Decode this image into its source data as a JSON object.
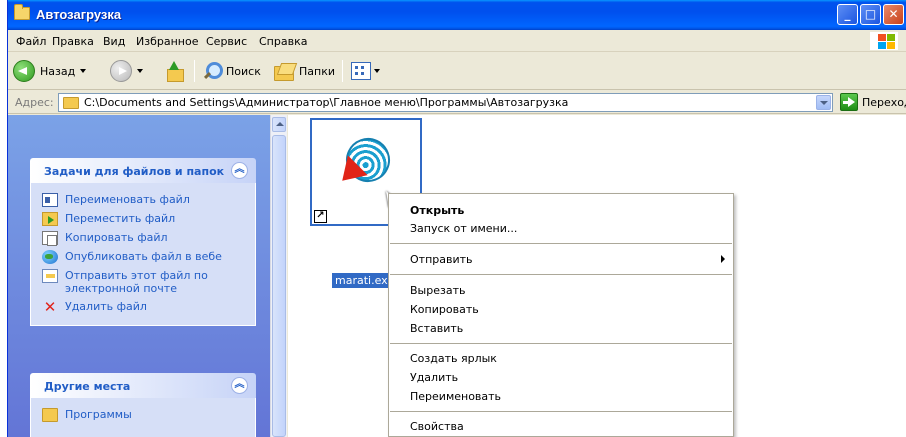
{
  "window": {
    "title": "Автозагрузка"
  },
  "menubar": {
    "items": [
      "Файл",
      "Правка",
      "Вид",
      "Избранное",
      "Сервис",
      "Справка"
    ]
  },
  "toolbar": {
    "back_label": "Назад",
    "search_label": "Поиск",
    "folders_label": "Папки"
  },
  "address": {
    "label": "Адрес:",
    "path": "C:\\Documents and Settings\\Администратор\\Главное меню\\Программы\\Автозагрузка",
    "go_label": "Переход"
  },
  "tasks_panel": {
    "title": "Задачи для файлов и папок",
    "items": [
      {
        "label": "Переименовать файл",
        "icon": "rename-icon"
      },
      {
        "label": "Переместить файл",
        "icon": "move-icon"
      },
      {
        "label": "Копировать файл",
        "icon": "copy-icon"
      },
      {
        "label": "Опубликовать файл в вебе",
        "icon": "web-publish-icon"
      },
      {
        "label": "Отправить этот файл по электронной почте",
        "icon": "mail-icon"
      },
      {
        "label": "Удалить файл",
        "icon": "delete-icon"
      }
    ]
  },
  "other_places_panel": {
    "title": "Другие места",
    "items": [
      {
        "label": "Программы",
        "icon": "folder-icon"
      }
    ]
  },
  "file": {
    "name": "marati.exe",
    "name_visible": "marati.ex"
  },
  "context_menu": {
    "items": [
      {
        "label": "Открыть",
        "bold": true
      },
      {
        "label": "Запуск от имени..."
      },
      {
        "label": "Отправить",
        "submenu": true
      },
      {
        "label": "Вырезать"
      },
      {
        "label": "Копировать"
      },
      {
        "label": "Вставить"
      },
      {
        "label": "Создать ярлык"
      },
      {
        "label": "Удалить"
      },
      {
        "label": "Переименовать"
      },
      {
        "label": "Свойства"
      }
    ]
  },
  "colors": {
    "titlebar": "#0053ee",
    "selection": "#316ac5",
    "task_pane": "#6f8ddf",
    "link": "#215dc6"
  }
}
